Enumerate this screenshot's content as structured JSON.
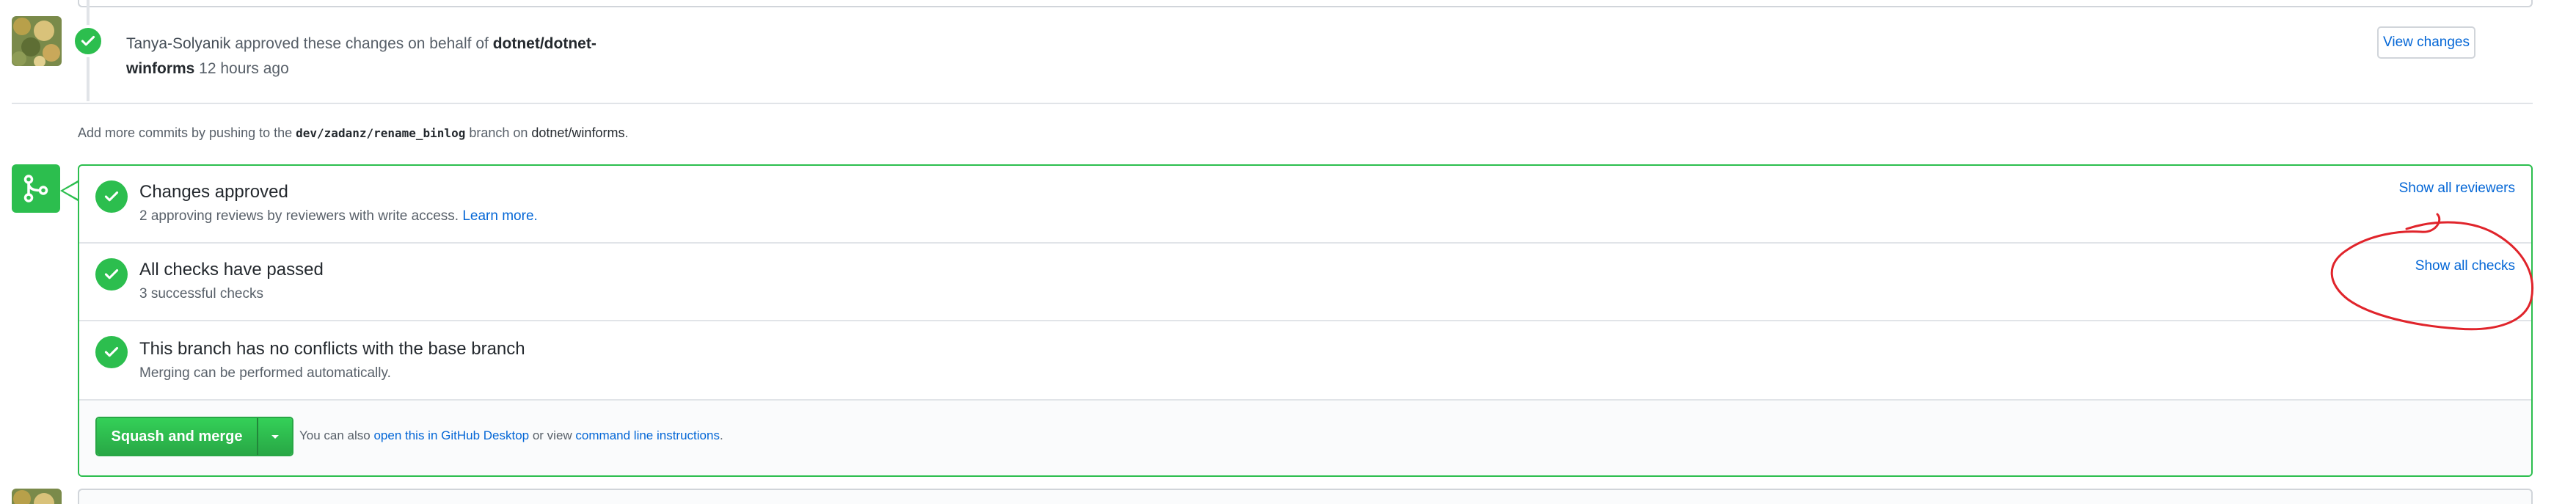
{
  "review": {
    "reviewer": "Tanya-Solyanik",
    "action": " approved these changes on behalf of ",
    "org_part1": "dotnet/dotnet-",
    "org_part2": "winforms",
    "time": " 12 hours ago",
    "view_changes_label": "View changes"
  },
  "commits_hint": {
    "prefix": "Add more commits by pushing to the ",
    "branch": "dev/zadanz/rename_binlog",
    "middle": " branch on ",
    "repo": "dotnet/winforms",
    "suffix": "."
  },
  "merge_box": {
    "approved": {
      "title": "Changes approved",
      "subtitle": "2 approving reviews by reviewers with write access. ",
      "learn_more": "Learn more.",
      "action": "Show all reviewers"
    },
    "checks": {
      "title": "All checks have passed",
      "subtitle": "3 successful checks",
      "action": "Show all checks"
    },
    "conflicts": {
      "title": "This branch has no conflicts with the base branch",
      "subtitle": "Merging can be performed automatically."
    },
    "footer": {
      "merge_button": "Squash and merge",
      "text_prefix": "You can also ",
      "desktop_link": "open this in GitHub Desktop",
      "text_middle": " or view ",
      "cli_link": "command line instructions",
      "text_suffix": "."
    }
  },
  "icons": {
    "check": "check-icon",
    "merge": "git-merge-icon",
    "caret": "triangle-down-icon"
  },
  "colors": {
    "success": "#2cbe4e",
    "link": "#0366d6",
    "annotation": "#e0242b"
  }
}
